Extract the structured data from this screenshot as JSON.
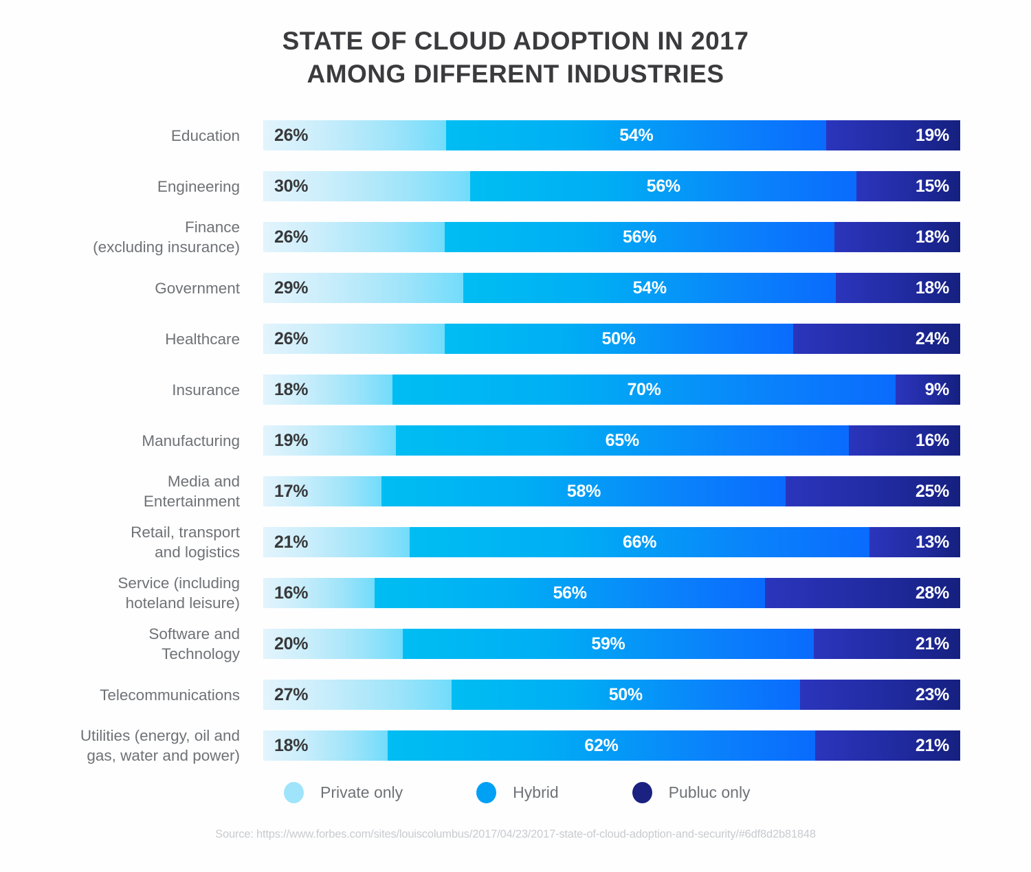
{
  "title": {
    "line1": "STATE OF CLOUD ADOPTION IN 2017",
    "line2": "AMONG DIFFERENT INDUSTRIES"
  },
  "legend": [
    {
      "label": "Private only",
      "color": "#9fe4fa"
    },
    {
      "label": "Hybrid",
      "color": "#00a0f5"
    },
    {
      "label": "Publuc only",
      "color": "#1a2180"
    }
  ],
  "source": "Source: https://www.forbes.com/sites/louiscolumbus/2017/04/23/2017-state-of-cloud-adoption-and-security/#6df8d2b81848",
  "chart_data": {
    "type": "bar",
    "orientation": "horizontal",
    "stacked": true,
    "title": "STATE OF CLOUD ADOPTION IN 2017 AMONG DIFFERENT INDUSTRIES",
    "xlabel": "",
    "ylabel": "",
    "xlim": [
      0,
      100
    ],
    "grid": false,
    "legend_position": "bottom",
    "value_suffix": "%",
    "categories": [
      "Education",
      "Engineering",
      "Finance\n(excluding insurance)",
      "Government",
      "Healthcare",
      "Insurance",
      "Manufacturing",
      "Media and\nEntertainment",
      "Retail, transport\nand logistics",
      "Service (including\nhoteland leisure)",
      "Software and\nTechnology",
      "Telecommunications",
      "Utilities (energy, oil and\ngas, water and power)"
    ],
    "series": [
      {
        "name": "Private only",
        "color": "#9fe4fa",
        "values": [
          26,
          30,
          26,
          29,
          26,
          18,
          19,
          17,
          21,
          16,
          20,
          27,
          18
        ]
      },
      {
        "name": "Hybrid",
        "color": "#00a0f5",
        "values": [
          54,
          56,
          56,
          54,
          50,
          70,
          65,
          58,
          66,
          56,
          59,
          50,
          62
        ]
      },
      {
        "name": "Publuc only",
        "color": "#1a2180",
        "values": [
          19,
          15,
          18,
          18,
          24,
          9,
          16,
          25,
          13,
          28,
          21,
          23,
          21
        ]
      }
    ],
    "rows": [
      {
        "category": "Education",
        "private": 26,
        "hybrid": 54,
        "public": 19,
        "private_label": "26%",
        "hybrid_label": "54%",
        "public_label": "19%"
      },
      {
        "category": "Engineering",
        "private": 30,
        "hybrid": 56,
        "public": 15,
        "private_label": "30%",
        "hybrid_label": "56%",
        "public_label": "15%"
      },
      {
        "category": "Finance\n(excluding insurance)",
        "private": 26,
        "hybrid": 56,
        "public": 18,
        "private_label": "26%",
        "hybrid_label": "56%",
        "public_label": "18%"
      },
      {
        "category": "Government",
        "private": 29,
        "hybrid": 54,
        "public": 18,
        "private_label": "29%",
        "hybrid_label": "54%",
        "public_label": "18%"
      },
      {
        "category": "Healthcare",
        "private": 26,
        "hybrid": 50,
        "public": 24,
        "private_label": "26%",
        "hybrid_label": "50%",
        "public_label": "24%"
      },
      {
        "category": "Insurance",
        "private": 18,
        "hybrid": 70,
        "public": 9,
        "private_label": "18%",
        "hybrid_label": "70%",
        "public_label": "9%"
      },
      {
        "category": "Manufacturing",
        "private": 19,
        "hybrid": 65,
        "public": 16,
        "private_label": "19%",
        "hybrid_label": "65%",
        "public_label": "16%"
      },
      {
        "category": "Media and\nEntertainment",
        "private": 17,
        "hybrid": 58,
        "public": 25,
        "private_label": "17%",
        "hybrid_label": "58%",
        "public_label": "25%"
      },
      {
        "category": "Retail, transport\nand logistics",
        "private": 21,
        "hybrid": 66,
        "public": 13,
        "private_label": "21%",
        "hybrid_label": "66%",
        "public_label": "13%"
      },
      {
        "category": "Service (including\nhoteland leisure)",
        "private": 16,
        "hybrid": 56,
        "public": 28,
        "private_label": "16%",
        "hybrid_label": "56%",
        "public_label": "28%"
      },
      {
        "category": "Software and\nTechnology",
        "private": 20,
        "hybrid": 59,
        "public": 21,
        "private_label": "20%",
        "hybrid_label": "59%",
        "public_label": "21%"
      },
      {
        "category": "Telecommunications",
        "private": 27,
        "hybrid": 50,
        "public": 23,
        "private_label": "27%",
        "hybrid_label": "50%",
        "public_label": "23%"
      },
      {
        "category": "Utilities (energy, oil and\ngas, water and power)",
        "private": 18,
        "hybrid": 62,
        "public": 21,
        "private_label": "18%",
        "hybrid_label": "62%",
        "public_label": "21%"
      }
    ]
  }
}
